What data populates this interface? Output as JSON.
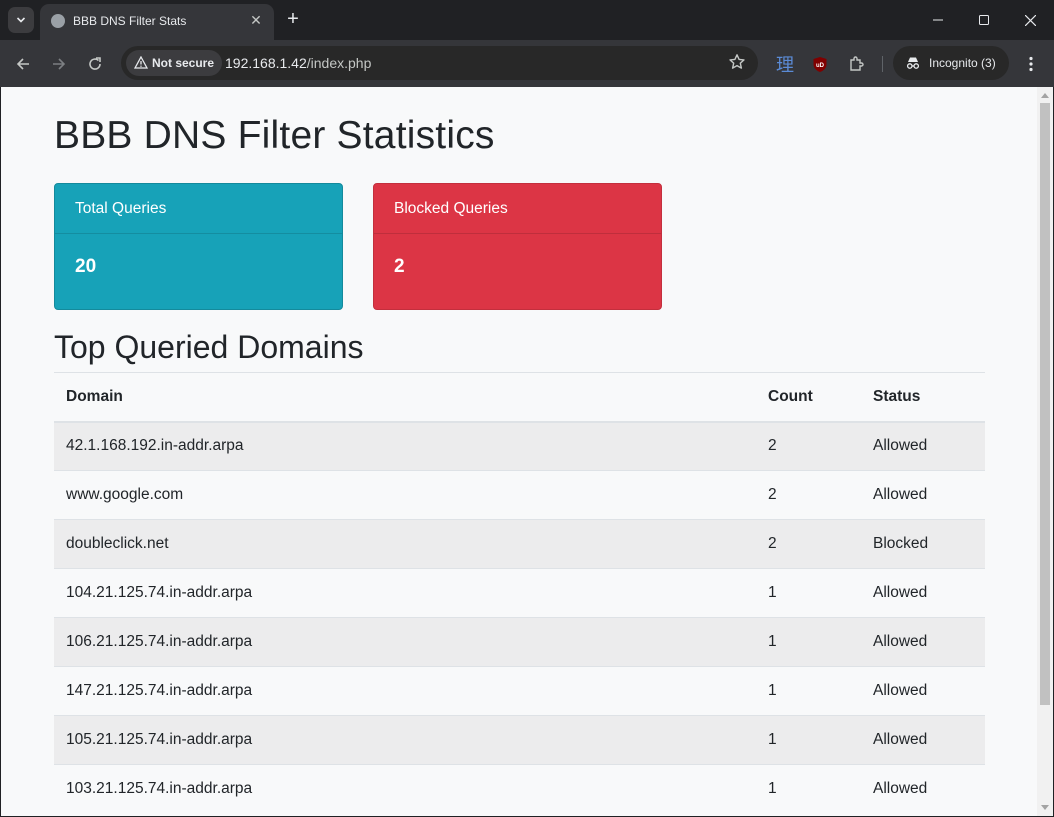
{
  "browser": {
    "tab_title": "BBB DNS Filter Stats",
    "security_label": "Not secure",
    "url_host": "192.168.1.42",
    "url_path": "/index.php",
    "incognito_label": "Incognito (3)",
    "extension_char": "理"
  },
  "page": {
    "title": "BBB DNS Filter Statistics",
    "cards": [
      {
        "label": "Total Queries",
        "value": "20",
        "color": "#17a2b8"
      },
      {
        "label": "Blocked Queries",
        "value": "2",
        "color": "#dc3545"
      }
    ],
    "section_title": "Top Queried Domains",
    "table": {
      "headers": [
        "Domain",
        "Count",
        "Status"
      ],
      "rows": [
        [
          "42.1.168.192.in-addr.arpa",
          "2",
          "Allowed"
        ],
        [
          "www.google.com",
          "2",
          "Allowed"
        ],
        [
          "doubleclick.net",
          "2",
          "Blocked"
        ],
        [
          "104.21.125.74.in-addr.arpa",
          "1",
          "Allowed"
        ],
        [
          "106.21.125.74.in-addr.arpa",
          "1",
          "Allowed"
        ],
        [
          "147.21.125.74.in-addr.arpa",
          "1",
          "Allowed"
        ],
        [
          "105.21.125.74.in-addr.arpa",
          "1",
          "Allowed"
        ],
        [
          "103.21.125.74.in-addr.arpa",
          "1",
          "Allowed"
        ]
      ]
    }
  }
}
